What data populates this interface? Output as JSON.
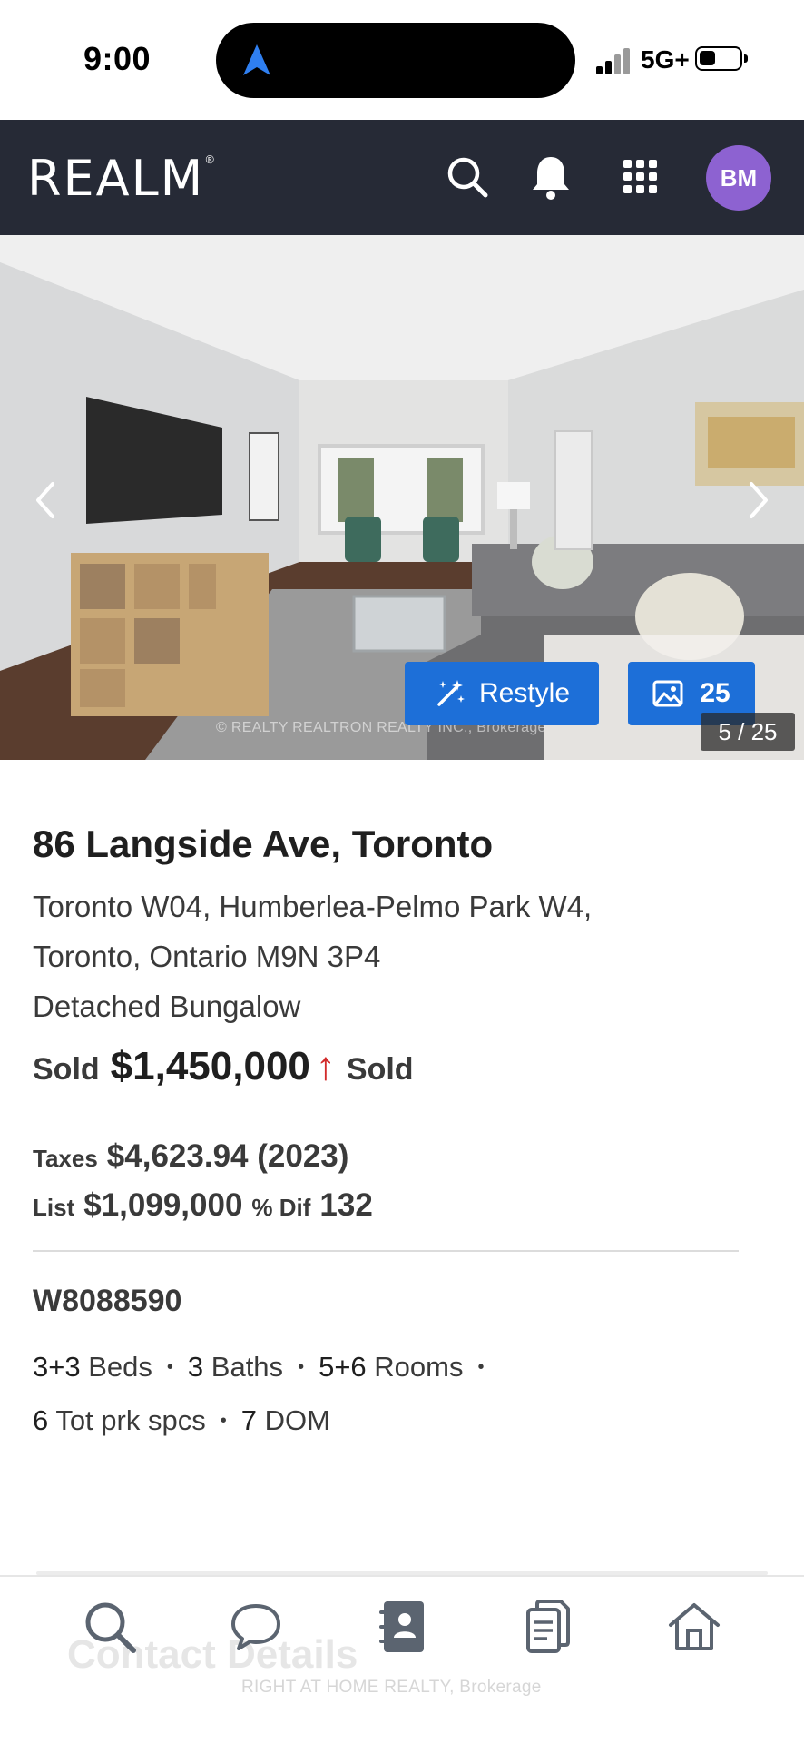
{
  "status_bar": {
    "time": "9:00",
    "network": "5G+"
  },
  "header": {
    "logo": "REALM",
    "avatar_initials": "BM"
  },
  "gallery": {
    "restyle_label": "Restyle",
    "photo_count": "25",
    "counter": "5 / 25",
    "watermark": "© REALTY REALTRON REALTY INC., Brokerage"
  },
  "listing": {
    "address": "86 Langside Ave, Toronto",
    "area_line1": "Toronto W04, Humberlea-Pelmo Park W4,",
    "area_line2": "Toronto, Ontario M9N 3P4",
    "style": "Detached Bungalow",
    "status_label": "Sold",
    "price": "$1,450,000",
    "status_label_2": "Sold",
    "taxes_label": "Taxes",
    "taxes_value": "$4,623.94 (2023)",
    "list_label": "List",
    "list_value": "$1,099,000",
    "dif_label": "% Dif",
    "dif_value": "132",
    "mls": "W8088590",
    "beds_num": "3+3",
    "beds_label": "Beds",
    "baths_num": "3",
    "baths_label": "Baths",
    "rooms_num": "5+6",
    "rooms_label": "Rooms",
    "parking_num": "6",
    "parking_label": "Tot prk spcs",
    "dom_num": "7",
    "dom_label": "DOM"
  },
  "contact": {
    "heading": "Contact Details"
  },
  "footer": {
    "watermark": "RIGHT AT HOME REALTY, Brokerage"
  },
  "colors": {
    "header_bg": "#262a36",
    "accent_blue": "#1d6fd8",
    "avatar": "#8d62d1",
    "price_up": "#d22b2b"
  }
}
